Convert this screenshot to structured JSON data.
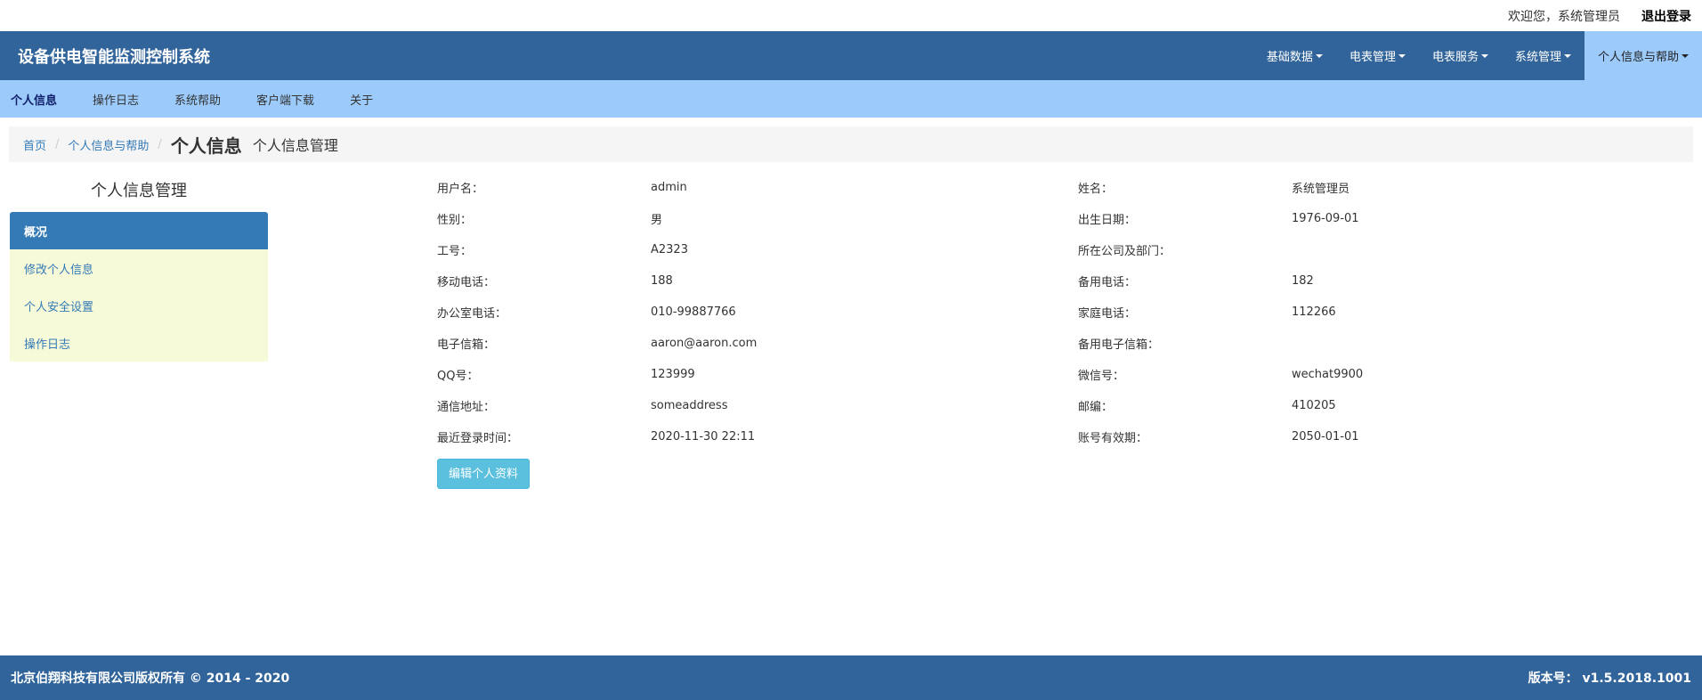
{
  "topbar": {
    "welcome": "欢迎您，系统管理员",
    "logout": "退出登录"
  },
  "navbar": {
    "brand": "设备供电智能监测控制系统",
    "menus": [
      {
        "label": "基础数据"
      },
      {
        "label": "电表管理"
      },
      {
        "label": "电表服务"
      },
      {
        "label": "系统管理"
      },
      {
        "label": "个人信息与帮助"
      }
    ]
  },
  "subnav": {
    "items": [
      {
        "label": "个人信息"
      },
      {
        "label": "操作日志"
      },
      {
        "label": "系统帮助"
      },
      {
        "label": "客户端下载"
      },
      {
        "label": "关于"
      }
    ]
  },
  "breadcrumb": {
    "home": "首页",
    "parent": "个人信息与帮助",
    "title": "个人信息",
    "subtitle": "个人信息管理"
  },
  "sidebar": {
    "title": "个人信息管理",
    "items": [
      {
        "label": "概况"
      },
      {
        "label": "修改个人信息"
      },
      {
        "label": "个人安全设置"
      },
      {
        "label": "操作日志"
      }
    ]
  },
  "profile": {
    "rows": [
      {
        "l1": "用户名：",
        "v1": "admin",
        "l2": "姓名：",
        "v2": "系统管理员"
      },
      {
        "l1": "性别：",
        "v1": "男",
        "l2": "出生日期：",
        "v2": "1976-09-01"
      },
      {
        "l1": "工号：",
        "v1": "A2323",
        "l2": "所在公司及部门：",
        "v2": ""
      },
      {
        "l1": "移动电话：",
        "v1": "188",
        "l2": "备用电话：",
        "v2": "182"
      },
      {
        "l1": "办公室电话：",
        "v1": "010-99887766",
        "l2": "家庭电话：",
        "v2": "112266"
      },
      {
        "l1": "电子信箱：",
        "v1": "aaron@aaron.com",
        "l2": "备用电子信箱：",
        "v2": ""
      },
      {
        "l1": "QQ号：",
        "v1": "123999",
        "l2": "微信号：",
        "v2": "wechat9900"
      },
      {
        "l1": "通信地址：",
        "v1": "someaddress",
        "l2": "邮编：",
        "v2": "410205"
      },
      {
        "l1": "最近登录时间：",
        "v1": "2020-11-30 22:11",
        "l2": "账号有效期：",
        "v2": "2050-01-01"
      }
    ],
    "edit_button": "编辑个人资料"
  },
  "footer": {
    "copyright": "北京伯翔科技有限公司版权所有 © 2014 - 2020",
    "version": "版本号： v1.5.2018.1001"
  },
  "colors": {
    "primary": "#30649a",
    "subnav": "#9ccbfb",
    "sidebar_bg": "#f7fad8",
    "button": "#5bc0de"
  }
}
